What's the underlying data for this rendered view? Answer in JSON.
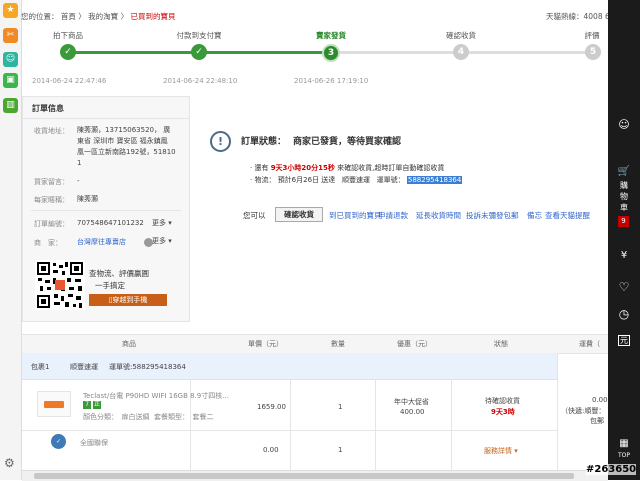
{
  "left_sidebar": {
    "icons": [
      {
        "name": "star-icon",
        "glyph": "★",
        "color": "#f5a623"
      },
      {
        "name": "tools-icon",
        "glyph": "✂",
        "color": "#f08a24"
      },
      {
        "name": "person-icon",
        "glyph": "☺",
        "color": "#2cb5a0"
      },
      {
        "name": "bag-icon",
        "glyph": "▣",
        "color": "#3cb54a"
      },
      {
        "name": "shop-icon",
        "glyph": "▤",
        "color": "#e8572d"
      },
      {
        "name": "package-icon",
        "glyph": "▥",
        "color": "#4aa831"
      }
    ],
    "settings_glyph": "⚙"
  },
  "breadcrumb": {
    "prefix": "您的位置：",
    "home": "首頁",
    "sep1": "〉",
    "my_taobao": "我的淘寶",
    "sep2": "〉",
    "current": "已買到的寶貝"
  },
  "header_right": "天貓熱線：4008 6",
  "steps": [
    {
      "label": "拍下商品",
      "badge": "✓",
      "date": "2014-06-24 22:47:46",
      "state": "done"
    },
    {
      "label": "付款到支付寶",
      "badge": "✓",
      "date": "2014-06-24 22:48:10",
      "state": "done"
    },
    {
      "label": "賣家發貨",
      "badge": "3",
      "date": "2014-06-26 17:19:10",
      "state": "current"
    },
    {
      "label": "確認收貨",
      "badge": "4",
      "date": "",
      "state": "todo"
    },
    {
      "label": "評價",
      "badge": "5",
      "date": "",
      "state": "todo"
    }
  ],
  "order_info": {
    "title": "訂單信息",
    "address_label": "收貨地址：",
    "address_lines": [
      "陳莠灝，13715063520， 廣",
      "東省 深圳市 寶安區 福永鎮鳳",
      "凰一區立新南路192號，51810",
      "1"
    ],
    "message_label": "買家留言：",
    "message_value": "-",
    "nickname_label": "每家暱稱：",
    "nickname_value": "陳莠灝",
    "order_no_label": "訂單編號：",
    "order_no_value": "707548647101232",
    "more1": "更多",
    "seller_label": "商　家：",
    "seller_value": "台灣摩往專賣店",
    "more2": "更多",
    "qr_line1": "查物流、評價贏圓",
    "qr_line2": "一手搞定",
    "qr_button": "穿越到手機"
  },
  "status": {
    "label": "訂單狀態：",
    "text": "商家已發貨，等待買家確認",
    "line1_prefix": "· 還有",
    "countdown": "9天3小時20分15秒",
    "line1_suffix": "來確認收貨,超時訂單自動確認收貨",
    "line2_prefix": "· 物流：",
    "line2_mid": "預計6月26日 送達",
    "carrier": "順豐速運",
    "tracking_label": "運單號：",
    "tracking_no": "588295418364"
  },
  "actions": {
    "prefix": "您可以",
    "confirm": "確認收貨",
    "links": [
      "到已買到的寶貝",
      "申請退款",
      "延長收貨時間",
      "投訴未彌發包郵",
      "備忘",
      "查看天貓提醒"
    ]
  },
  "table": {
    "headers": [
      "商品",
      "單價（元）",
      "數量",
      "優惠（元）",
      "狀態",
      "運費（"
    ],
    "package_label": "包裹1",
    "package_carrier": "順豐速運",
    "package_tracking": "運單號:588295418364",
    "product_name": "Teclast/台電 P90HD WIFI 16GB 8.9寸四核...",
    "product_color": "顏色分類：　扉白送綢",
    "product_package": "套餐類型：　套餐二",
    "badge1": "7",
    "badge2": "正",
    "price": "1659.00",
    "qty": "1",
    "discount_line1": "年中大促省",
    "discount_line2": "400.00",
    "status_line1": "待確認收貨",
    "status_line2": "9天3時",
    "shipping_line1": "0.00",
    "shipping_line2": "（快遞:順豐：",
    "shipping_line3": "包郵",
    "warranty_name": "全國聯保",
    "warranty_price": "0.00",
    "warranty_qty": "1",
    "service_link": "服務詳情"
  },
  "right_sidebar": {
    "cart_label": [
      "購",
      "物",
      "車"
    ],
    "cart_count": "9",
    "items": [
      "¥",
      "♡",
      "◷",
      "元"
    ],
    "top": "TOP"
  },
  "watermark": "#263650"
}
